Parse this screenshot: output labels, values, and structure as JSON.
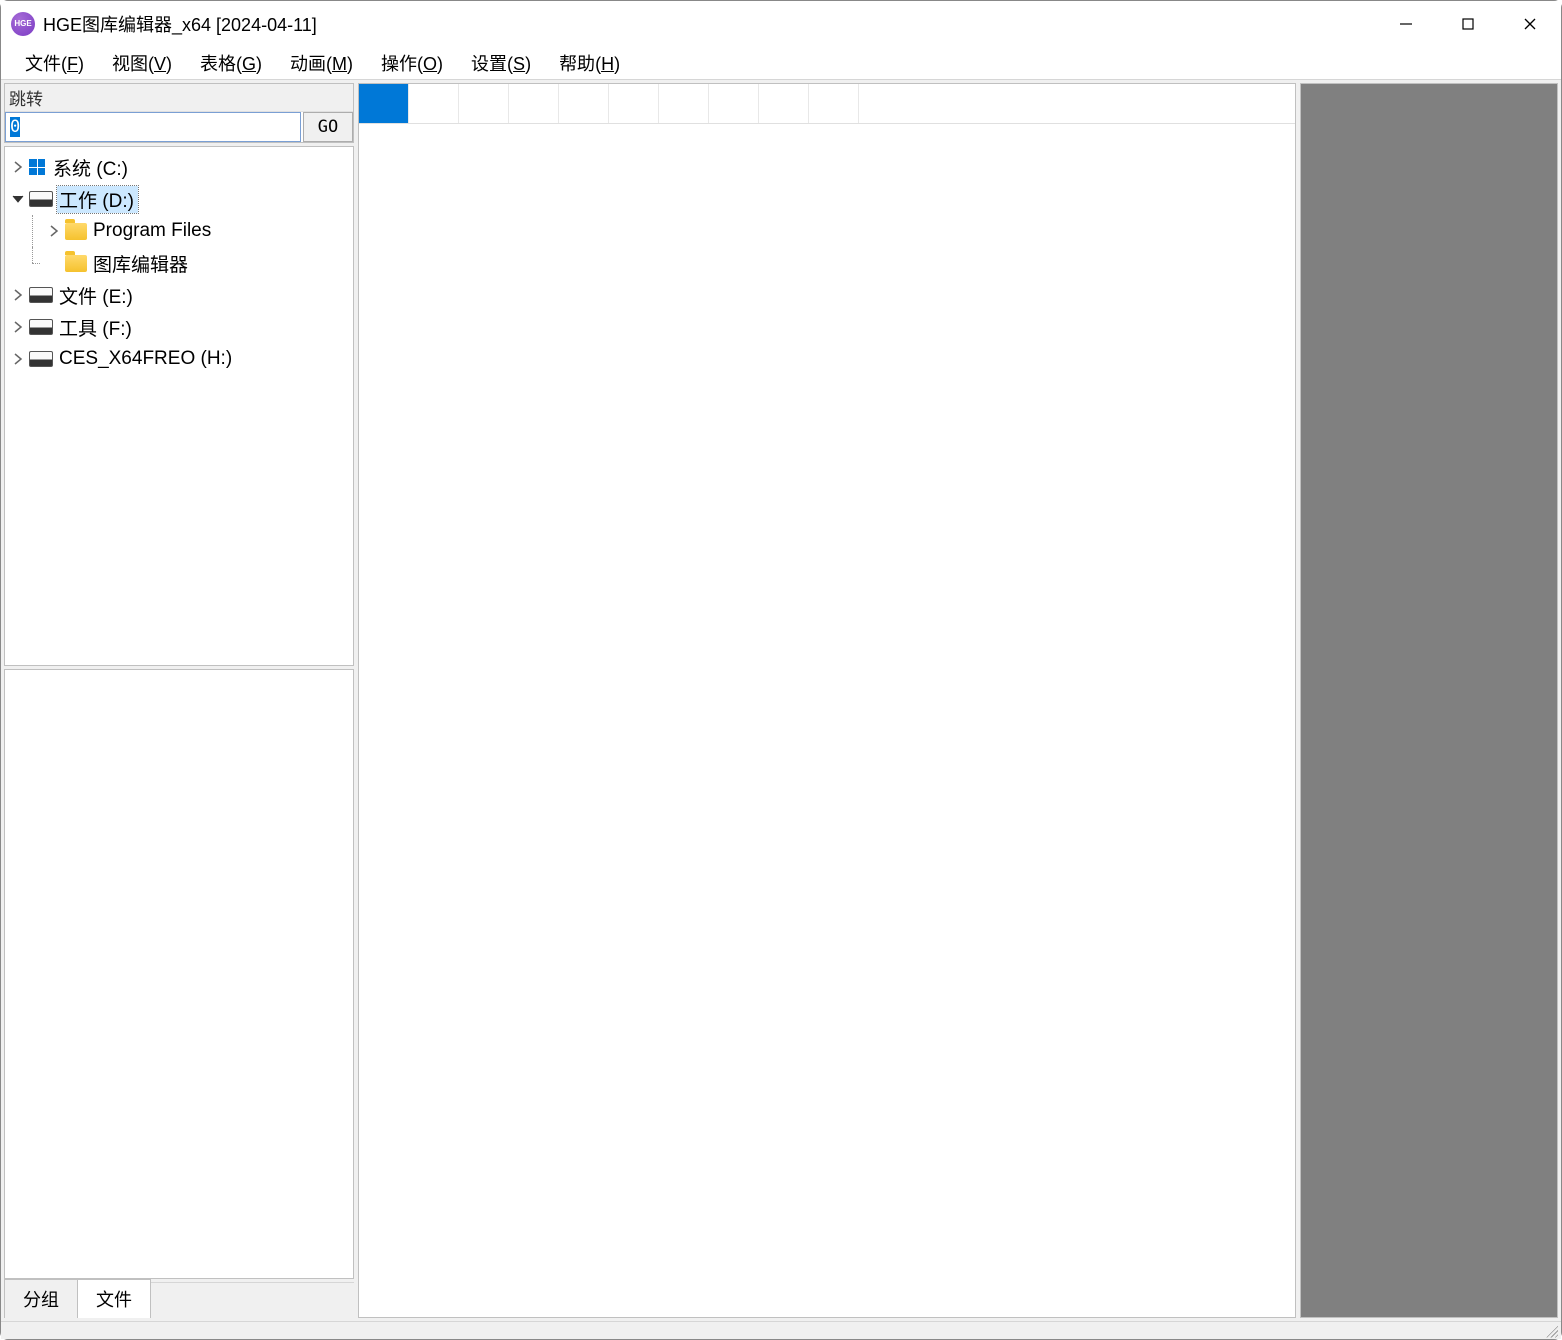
{
  "window": {
    "title": "HGE图库编辑器_x64 [2024-04-11]",
    "app_icon_text": "HGE"
  },
  "menu": {
    "file": {
      "label": "文件",
      "accel": "F"
    },
    "view": {
      "label": "视图",
      "accel": "V"
    },
    "table": {
      "label": "表格",
      "accel": "G"
    },
    "anim": {
      "label": "动画",
      "accel": "M"
    },
    "action": {
      "label": "操作",
      "accel": "O"
    },
    "settings": {
      "label": "设置",
      "accel": "S"
    },
    "help": {
      "label": "帮助",
      "accel": "H"
    }
  },
  "jump": {
    "label": "跳转",
    "value": "0",
    "go_label": "GO"
  },
  "tree": {
    "drive_c": "系统  (C:)",
    "drive_d": "工作 (D:)",
    "folder_program_files": "Program Files",
    "folder_editor": "图库编辑器",
    "drive_e": "文件 (E:)",
    "drive_f": "工具 (F:)",
    "drive_h": "CES_X64FREO (H:)"
  },
  "tabs": {
    "group": "分组",
    "file": "文件"
  },
  "grid": {
    "cell_count": 10,
    "selected_index": 0
  }
}
